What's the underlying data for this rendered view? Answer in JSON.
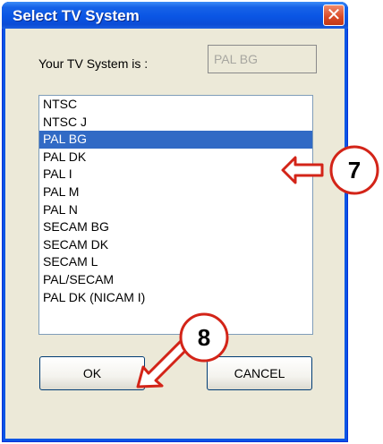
{
  "dialog": {
    "title": "Select TV System",
    "close_glyph": "✕"
  },
  "tv_system": {
    "label": "Your TV System is :",
    "value": "PAL BG"
  },
  "list": {
    "items": [
      "NTSC",
      "NTSC J",
      "PAL BG",
      "PAL DK",
      "PAL I",
      "PAL M",
      "PAL N",
      "SECAM BG",
      "SECAM DK",
      "SECAM L",
      "PAL/SECAM",
      "PAL DK (NICAM I)"
    ],
    "selected_index": 2
  },
  "buttons": {
    "ok": "OK",
    "cancel": "CANCEL"
  },
  "annotations": {
    "callout_7": "7",
    "callout_8": "8",
    "accent_color": "#d32418"
  }
}
